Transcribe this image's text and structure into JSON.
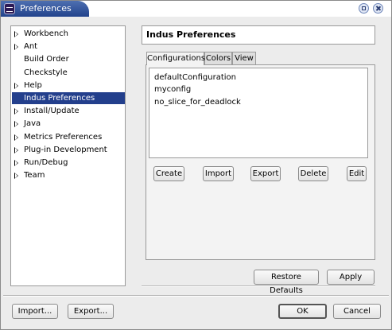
{
  "window": {
    "title": "Preferences"
  },
  "tree": {
    "items": [
      {
        "label": "Workbench",
        "expandable": true
      },
      {
        "label": "Ant",
        "expandable": true
      },
      {
        "label": "Build Order",
        "expandable": false
      },
      {
        "label": "Checkstyle",
        "expandable": false
      },
      {
        "label": "Help",
        "expandable": true
      },
      {
        "label": "Indus Preferences",
        "expandable": false,
        "selected": true
      },
      {
        "label": "Install/Update",
        "expandable": true
      },
      {
        "label": "Java",
        "expandable": true
      },
      {
        "label": "Metrics Preferences",
        "expandable": true
      },
      {
        "label": "Plug-in Development",
        "expandable": true
      },
      {
        "label": "Run/Debug",
        "expandable": true
      },
      {
        "label": "Team",
        "expandable": true
      }
    ]
  },
  "page": {
    "title": "Indus Preferences",
    "tabs": [
      {
        "label": "Configurations",
        "active": true
      },
      {
        "label": "Colors",
        "active": false
      },
      {
        "label": "View",
        "active": false
      }
    ],
    "configurations": [
      "defaultConfiguration",
      "myconfig",
      "no_slice_for_deadlock"
    ],
    "buttons": {
      "create": "Create",
      "import": "Import",
      "export": "Export",
      "delete": "Delete",
      "edit": "Edit"
    },
    "restore_defaults": "Restore Defaults",
    "apply": "Apply"
  },
  "footer": {
    "import": "Import...",
    "export": "Export...",
    "ok": "OK",
    "cancel": "Cancel"
  },
  "colors": {
    "title_bar": "#22438c",
    "selection": "#233f8c"
  }
}
